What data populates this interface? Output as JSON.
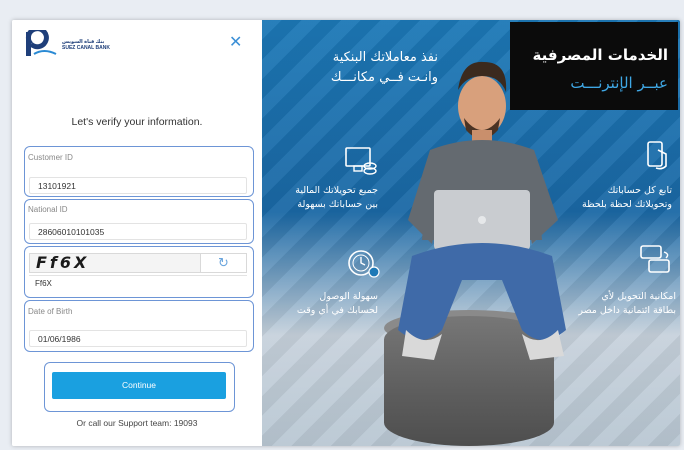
{
  "brand": {
    "name": "SUEZ CANAL BANK",
    "name_ar": "بنك قناة السويس"
  },
  "form": {
    "title": "Let's verify your information.",
    "customer_id": {
      "label": "Customer ID",
      "value": "13101921"
    },
    "national_id": {
      "label": "National ID",
      "value": "28606010101035"
    },
    "captcha": {
      "image_text": "Ff6X",
      "value": "Ff6X"
    },
    "dob": {
      "label": "Date of Birth",
      "value": "01/06/1986"
    },
    "continue_label": "Continue",
    "support_text": "Or call our Support team: 19093"
  },
  "promo": {
    "headline_line1": "نفذ معاملاتك البنكية",
    "headline_line2": "وانـت فــي مكانـــك",
    "banner_line1": "الخدمات المصرفية",
    "banner_line2": "عبــر الإنترنـــت",
    "features": [
      {
        "icon": "phone-hand-icon",
        "line1": "تابع كل حساباتك",
        "line2": "وتحويلاتك لحظة بلحظة"
      },
      {
        "icon": "transfer-cards-icon",
        "line1": "امكانية التحويل لأي",
        "line2": "بطاقة ائتمانية داخل مصر"
      },
      {
        "icon": "money-monitor-icon",
        "line1": "جميع تحويلاتك المالية",
        "line2": "بين حساباتك بسهولة"
      },
      {
        "icon": "clock-24-icon",
        "line1": "سهولة الوصول",
        "line2": "لحسابك في أي وقت"
      }
    ]
  },
  "colors": {
    "accent": "#1aa0e0",
    "field_border": "#6d95d6",
    "promo_blue": "#1c78b6"
  },
  "icons": {
    "close": "close-icon",
    "refresh": "refresh-icon"
  }
}
